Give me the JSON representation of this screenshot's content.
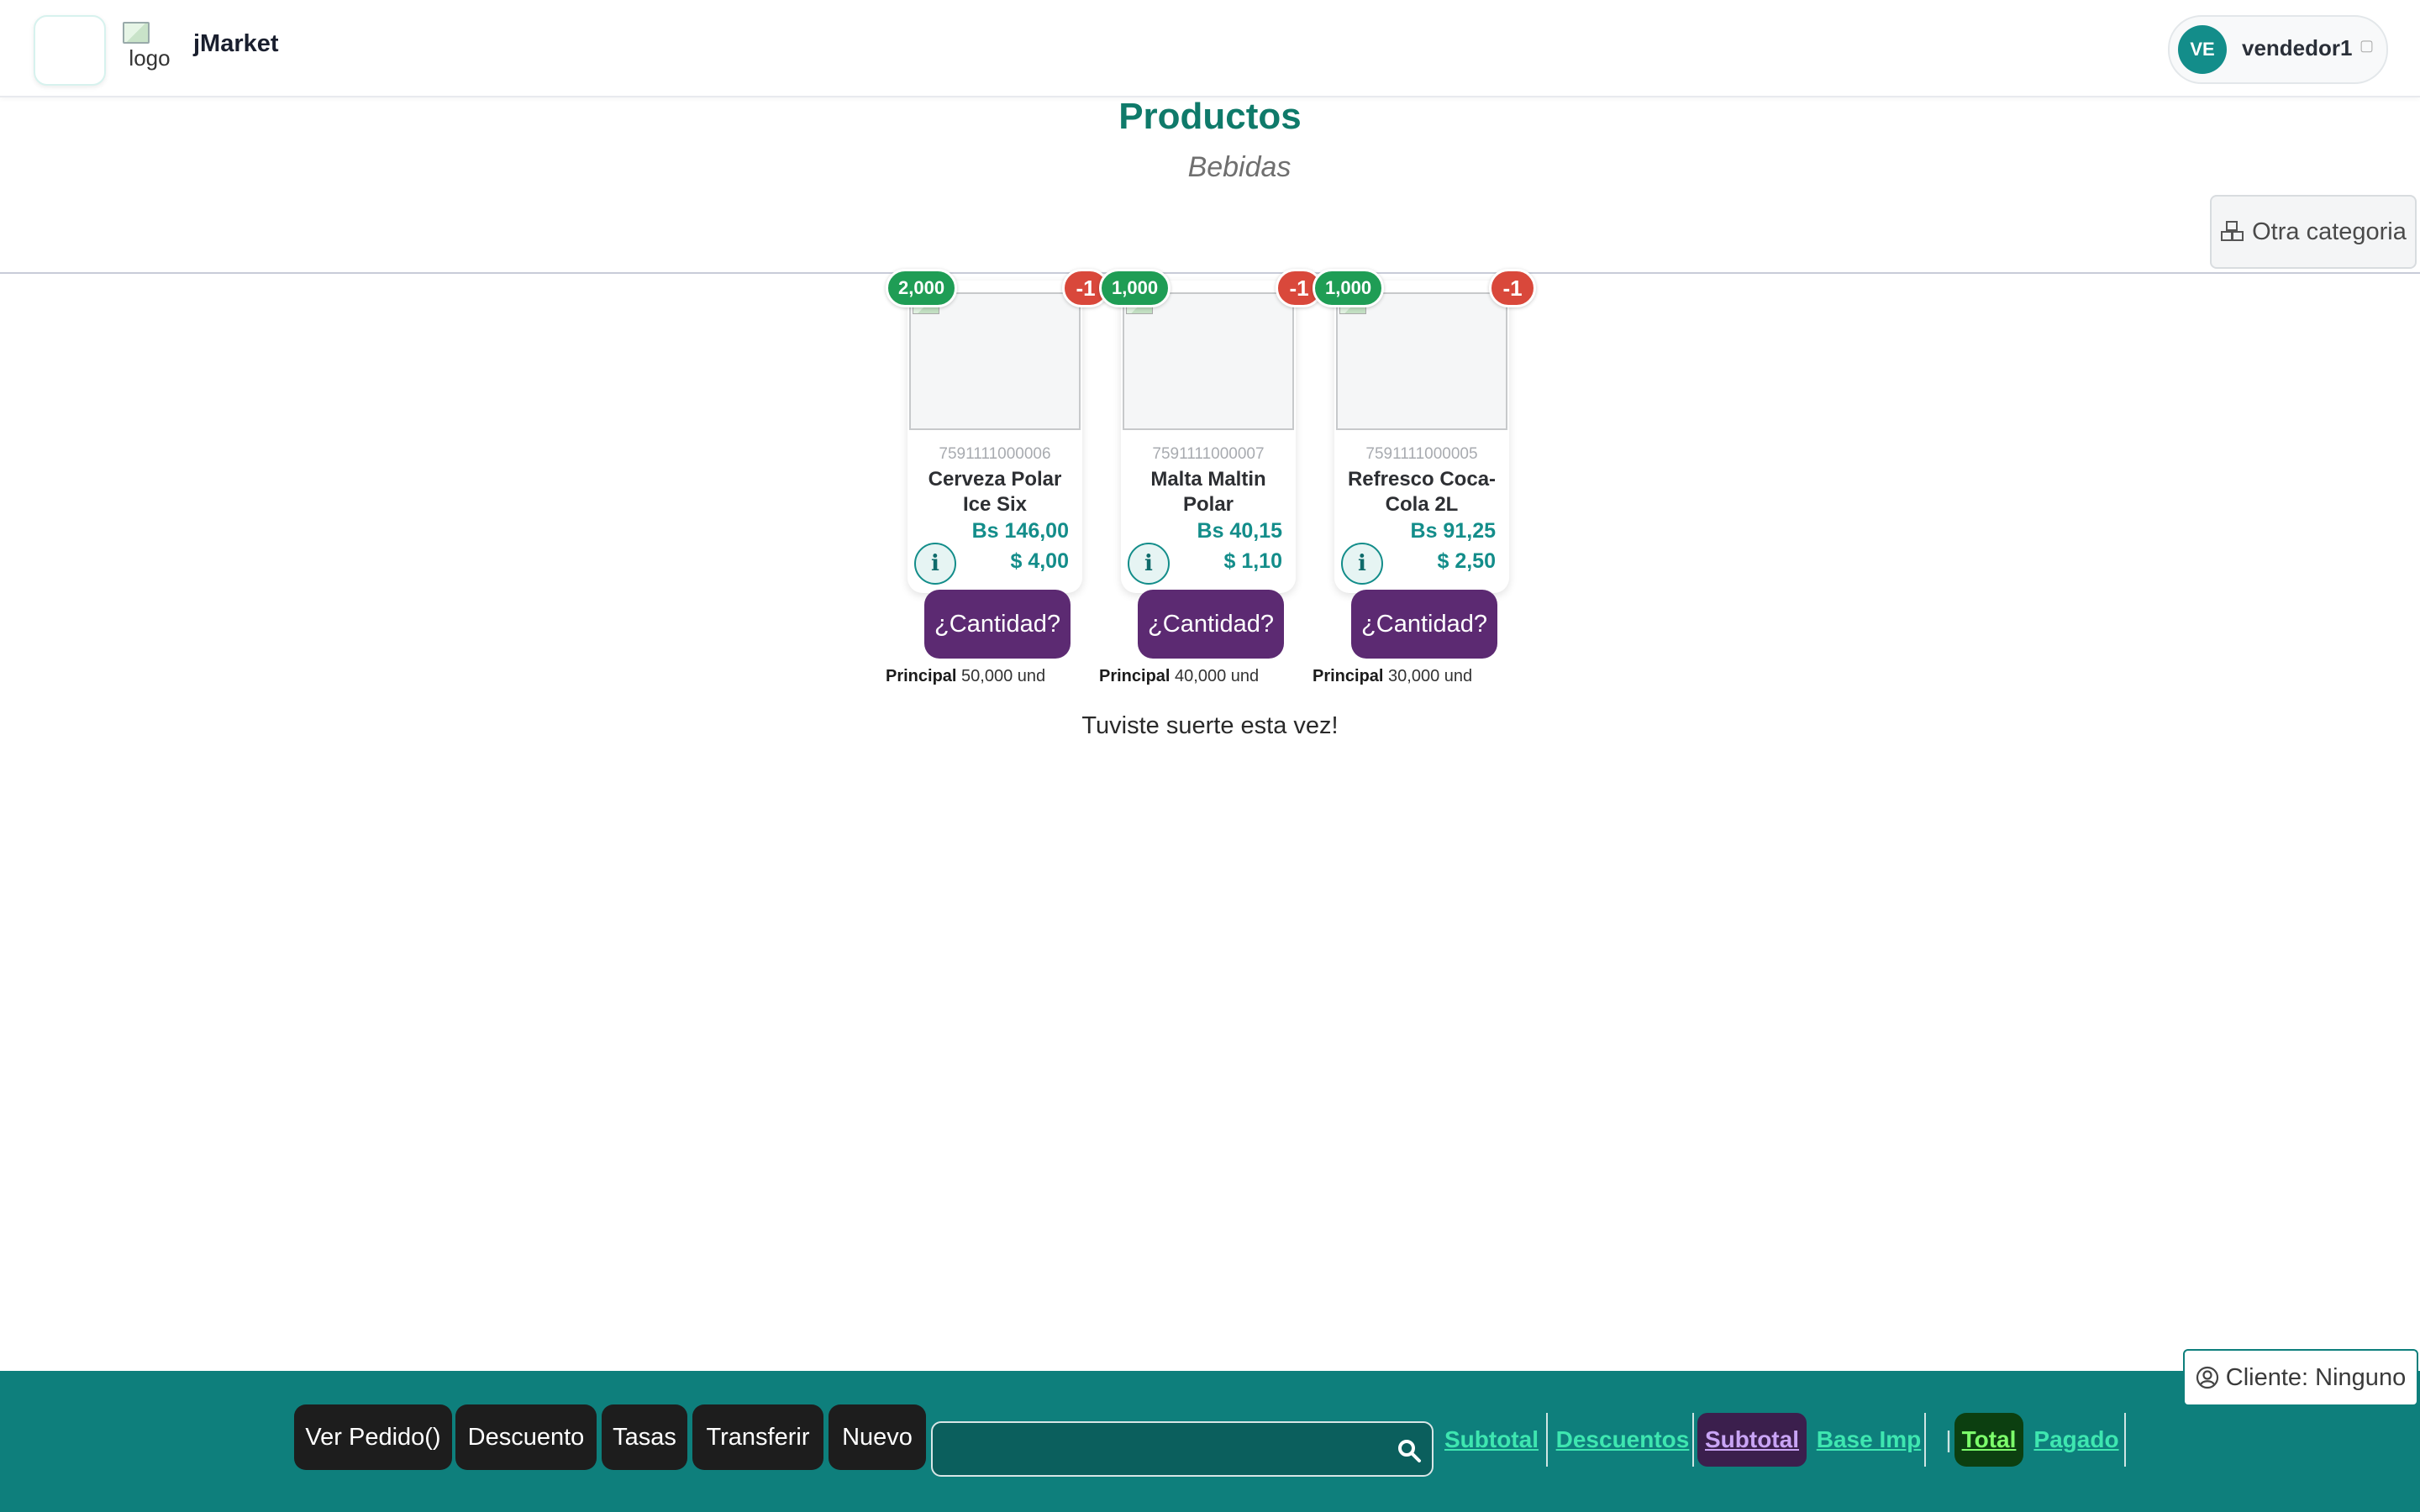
{
  "header": {
    "logo_alt": "logo",
    "brand": "jMarket",
    "user": {
      "initials": "VE",
      "name": "vendedor1",
      "caret": "▢"
    }
  },
  "page": {
    "title": "Productos",
    "subtitle": "Bebidas",
    "other_category_label": "Otra categoria",
    "message": "Tuviste suerte esta vez!"
  },
  "products": [
    {
      "stock_badge": "2,000",
      "minus_badge": "-1",
      "code": "7591111000006",
      "name": "Cerveza Polar Ice Six",
      "price_bs": "Bs 146,00",
      "price_usd": "$ 4,00",
      "qty_label": "¿Cantidad?",
      "warehouse": "Principal",
      "warehouse_stock": "50,000 und"
    },
    {
      "stock_badge": "1,000",
      "minus_badge": "-1",
      "code": "7591111000007",
      "name": "Malta Maltin Polar",
      "price_bs": "Bs 40,15",
      "price_usd": "$ 1,10",
      "qty_label": "¿Cantidad?",
      "warehouse": "Principal",
      "warehouse_stock": "40,000 und"
    },
    {
      "stock_badge": "1,000",
      "minus_badge": "-1",
      "code": "7591111000005",
      "name": "Refresco Coca-Cola 2L",
      "price_bs": "Bs 91,25",
      "price_usd": "$ 2,50",
      "qty_label": "¿Cantidad?",
      "warehouse": "Principal",
      "warehouse_stock": "30,000 und"
    }
  ],
  "footer": {
    "buttons": [
      "Ver Pedido()",
      "Descuento",
      "Tasas",
      "Transferir",
      "Nuevo"
    ],
    "search_placeholder": "",
    "totals": [
      "Subtotal",
      "Descuentos",
      "Subtotal",
      "Base Imp",
      "Total",
      "Pagado"
    ],
    "small_sep": "|",
    "client_label": "Cliente: Ninguno"
  },
  "colors": {
    "accent": "#138d8a",
    "footer_bg": "#0e7f7c",
    "qty_button": "#5c2a72",
    "stock_badge": "#1f9d55",
    "minus_badge": "#d9483b"
  }
}
